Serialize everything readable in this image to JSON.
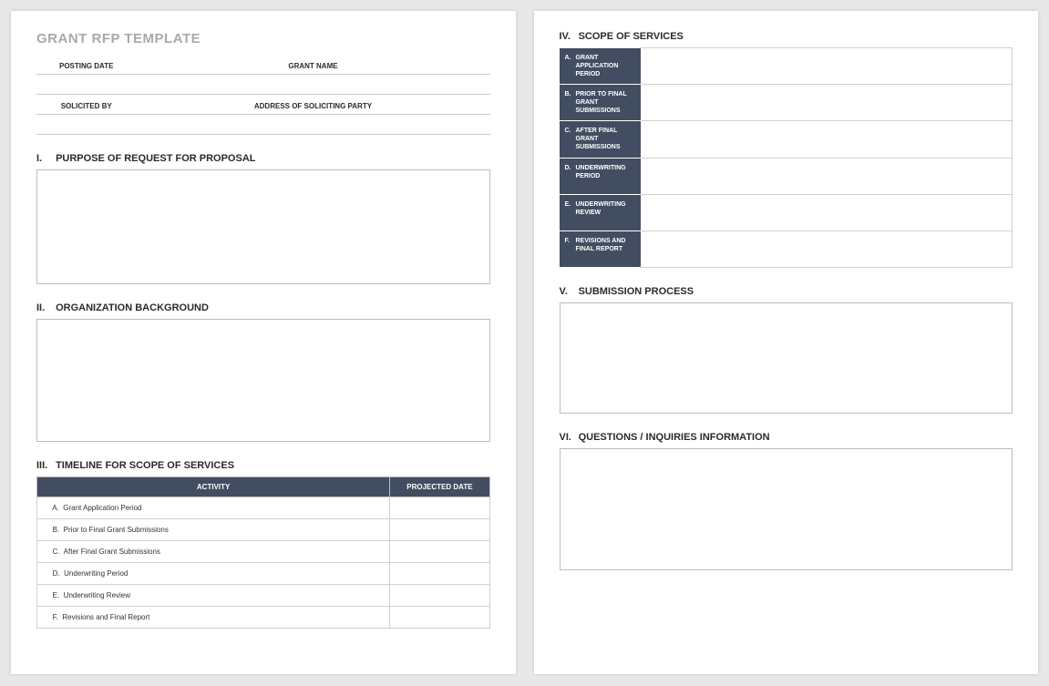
{
  "title": "GRANT RFP TEMPLATE",
  "info": {
    "posting_date_label": "POSTING DATE",
    "grant_name_label": "GRANT NAME",
    "solicited_by_label": "SOLICITED BY",
    "address_label": "ADDRESS OF SOLICITING PARTY"
  },
  "sections": {
    "s1_num": "I.",
    "s1_title": "PURPOSE OF REQUEST FOR PROPOSAL",
    "s2_num": "II.",
    "s2_title": "ORGANIZATION BACKGROUND",
    "s3_num": "III.",
    "s3_title": "TIMELINE FOR SCOPE OF SERVICES",
    "s4_num": "IV.",
    "s4_title": "SCOPE OF SERVICES",
    "s5_num": "V.",
    "s5_title": "SUBMISSION PROCESS",
    "s6_num": "VI.",
    "s6_title": "QUESTIONS / INQUIRIES INFORMATION"
  },
  "timeline": {
    "header_activity": "ACTIVITY",
    "header_date": "PROJECTED DATE",
    "rows": [
      {
        "letter": "A.",
        "label": "Grant Application Period"
      },
      {
        "letter": "B.",
        "label": "Prior to Final Grant Submissions"
      },
      {
        "letter": "C.",
        "label": "After Final Grant Submissions"
      },
      {
        "letter": "D.",
        "label": "Underwriting Period"
      },
      {
        "letter": "E.",
        "label": "Underwriting Review"
      },
      {
        "letter": "F.",
        "label": "Revisions and Final Report"
      }
    ]
  },
  "scope": {
    "rows": [
      {
        "letter": "A.",
        "label": "GRANT APPLICATION PERIOD"
      },
      {
        "letter": "B.",
        "label": "PRIOR TO FINAL GRANT SUBMISSIONS"
      },
      {
        "letter": "C.",
        "label": "AFTER FINAL GRANT SUBMISSIONS"
      },
      {
        "letter": "D.",
        "label": "UNDERWRITING PERIOD"
      },
      {
        "letter": "E.",
        "label": "UNDERWRITING REVIEW"
      },
      {
        "letter": "F.",
        "label": "REVISIONS AND FINAL REPORT"
      }
    ]
  }
}
